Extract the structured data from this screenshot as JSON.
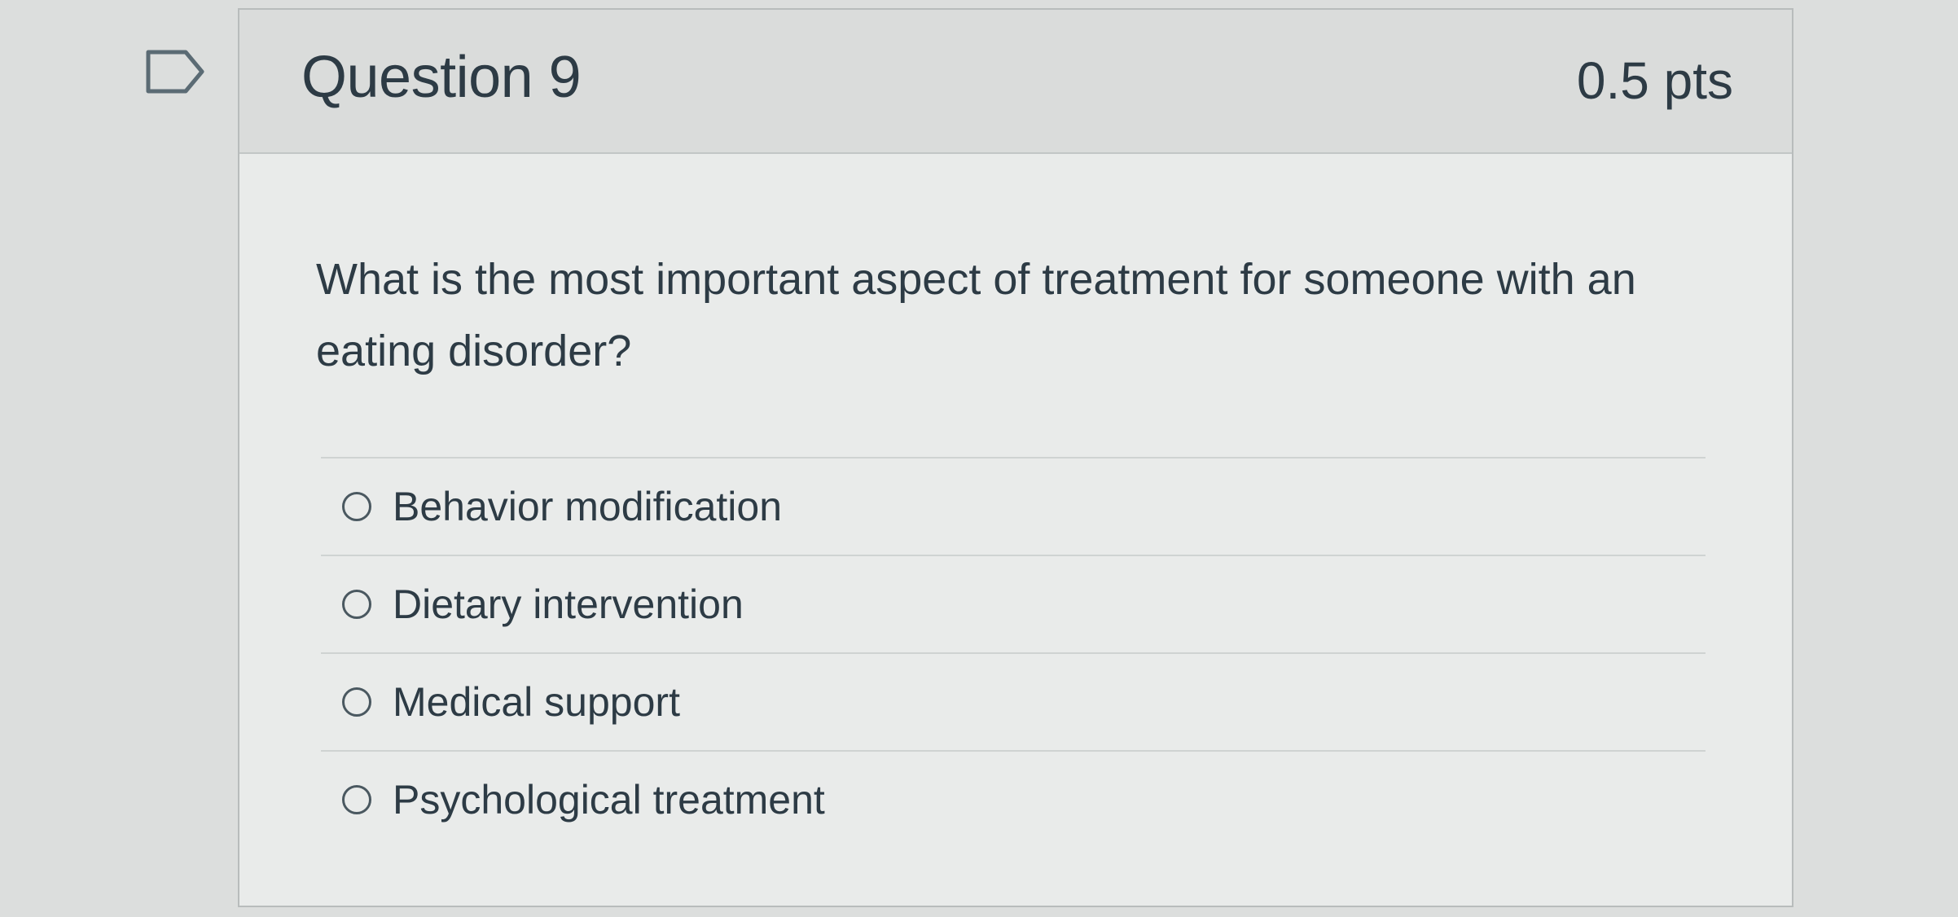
{
  "question": {
    "title": "Question 9",
    "points": "0.5 pts",
    "text": "What is the most important aspect of treatment for someone with an eating disorder?",
    "flag_icon": "flag-outline-icon"
  },
  "answers": [
    {
      "label": "Behavior modification"
    },
    {
      "label": "Dietary intervention"
    },
    {
      "label": "Medical support"
    },
    {
      "label": "Psychological treatment"
    }
  ],
  "colors": {
    "page_bg": "#dcdedd",
    "card_bg": "#e9ebea",
    "header_bg": "#dadcdb",
    "text": "#2d3b45"
  }
}
